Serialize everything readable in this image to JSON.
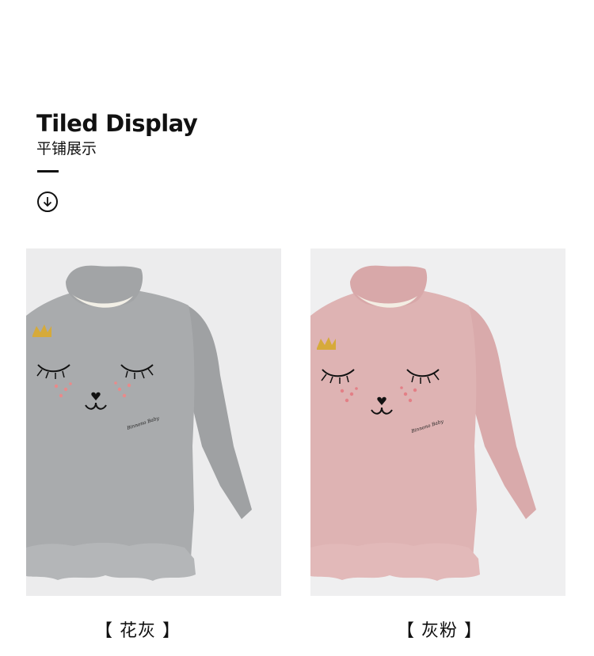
{
  "section": {
    "title": "Tiled Display",
    "subtitle": "平铺展示",
    "scroll_icon": "arrow-down-circle-icon"
  },
  "products": [
    {
      "caption": "【 花灰 】",
      "color_name": "花灰",
      "shirt_color": "#a9abad",
      "ruffle_color": "#b4b6b8",
      "brand_print": "Binnono Baby"
    },
    {
      "caption": "【 灰粉 】",
      "color_name": "灰粉",
      "shirt_color": "#deb3b3",
      "ruffle_color": "#e2b9b9",
      "brand_print": "Binnono Baby"
    }
  ]
}
